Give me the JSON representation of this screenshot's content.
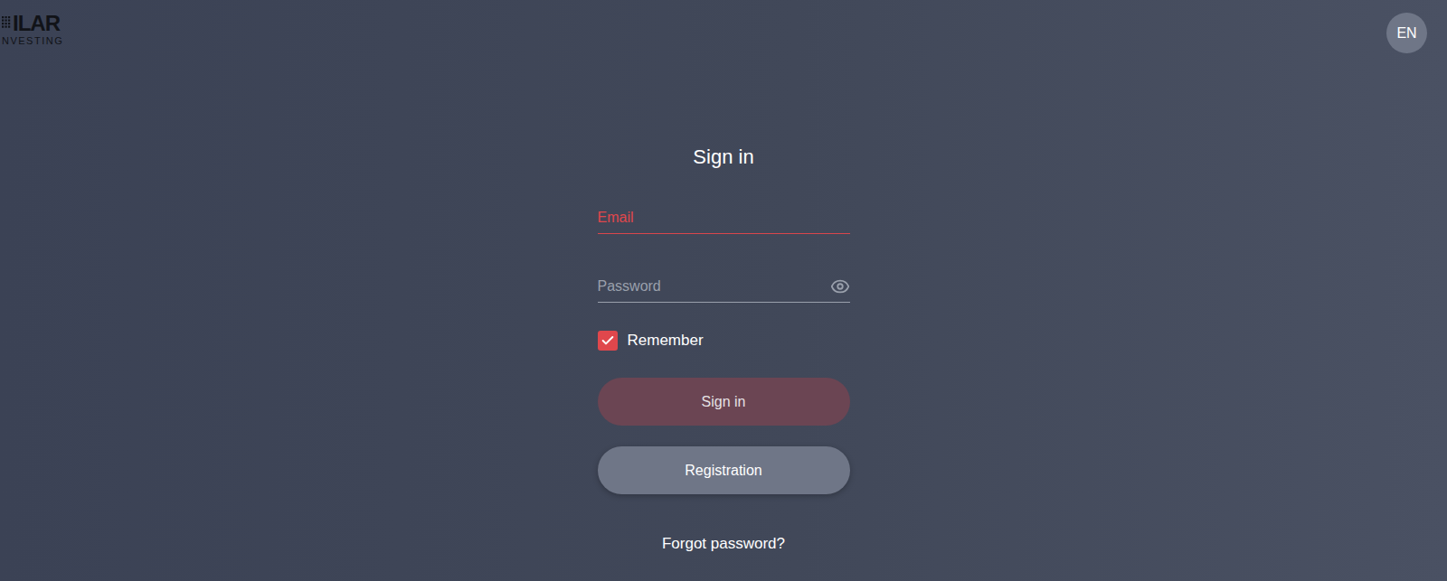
{
  "logo": {
    "mark": "ILAR",
    "tagline": "NVESTING"
  },
  "language": "EN",
  "form": {
    "title": "Sign in",
    "fields": [
      {
        "label": "Email",
        "kind": "text",
        "focused": true
      },
      {
        "label": "Password",
        "kind": "password",
        "focused": false
      }
    ],
    "remember": {
      "label": "Remember",
      "checked": true
    },
    "buttons": [
      {
        "label": "Sign in",
        "kind": "primary",
        "disabled": true
      },
      {
        "label": "Registration",
        "kind": "secondary",
        "disabled": false
      }
    ],
    "forgot": "Forgot password?"
  }
}
